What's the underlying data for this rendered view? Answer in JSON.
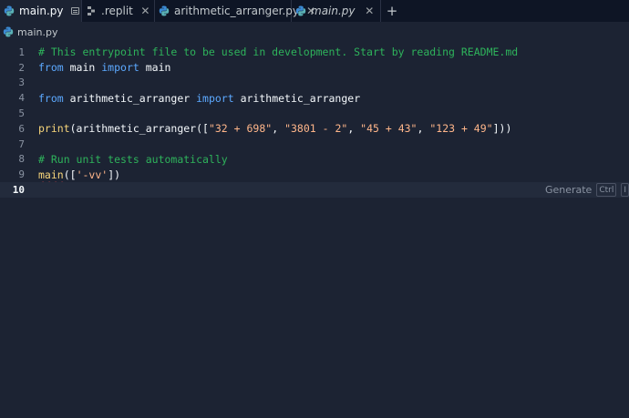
{
  "tabs": [
    {
      "label": "main.py",
      "icon": "python-icon",
      "active": true,
      "italic": false
    },
    {
      "label": ".replit",
      "icon": "replit-config-icon",
      "active": false,
      "italic": false
    },
    {
      "label": "arithmetic_arranger.py",
      "icon": "python-icon",
      "active": false,
      "italic": false
    },
    {
      "label": "main.py",
      "icon": "python-icon",
      "active": false,
      "italic": true
    }
  ],
  "add_tab_label": "+",
  "breadcrumb": {
    "label": "main.py",
    "icon": "python-icon"
  },
  "editor": {
    "lines": [
      {
        "number": "1",
        "text": "# This entrypoint file to be used in development. Start by reading README.md"
      },
      {
        "number": "2",
        "text": "from main import main"
      },
      {
        "number": "3",
        "text": ""
      },
      {
        "number": "4",
        "text": "from arithmetic_arranger import arithmetic_arranger"
      },
      {
        "number": "5",
        "text": ""
      },
      {
        "number": "6",
        "text": "print(arithmetic_arranger([\"32 + 698\", \"3801 - 2\", \"45 + 43\", \"123 + 49\"]))"
      },
      {
        "number": "7",
        "text": ""
      },
      {
        "number": "8",
        "text": "# Run unit tests automatically"
      },
      {
        "number": "9",
        "text": "main(['-vv'])"
      },
      {
        "number": "10",
        "text": ""
      }
    ],
    "tokens": {
      "l1": "# This entrypoint file to be used in development. Start by reading README.md",
      "l2_kw1": "from",
      "l2_mod": " main ",
      "l2_kw2": "import",
      "l2_name": " main",
      "l4_kw1": "from",
      "l4_mod": " arithmetic_arranger ",
      "l4_kw2": "import",
      "l4_name": " arithmetic_arranger",
      "l6_print": "print",
      "l6_open": "(arithmetic_arranger([",
      "l6_s1": "\"32 + 698\"",
      "l6_c1": ", ",
      "l6_s2": "\"3801 - 2\"",
      "l6_c2": ", ",
      "l6_s3": "\"45 + 43\"",
      "l6_c3": ", ",
      "l6_s4": "\"123 + 49\"",
      "l6_close": "]))",
      "l8": "# Run unit tests automatically",
      "l9_fn": "main",
      "l9_open": "([",
      "l9_str": "'-vv'",
      "l9_close": "])"
    },
    "current_line": 10,
    "generate_hint": "Generate",
    "generate_shortcut": "Ctrl",
    "generate_shortcut2": "I"
  },
  "colors": {
    "background": "#1c2333",
    "tabbar": "#0e1525",
    "comment": "#2eb35b",
    "keyword": "#5ca9ff",
    "string": "#ffb68a",
    "text": "#f5f9fc"
  }
}
